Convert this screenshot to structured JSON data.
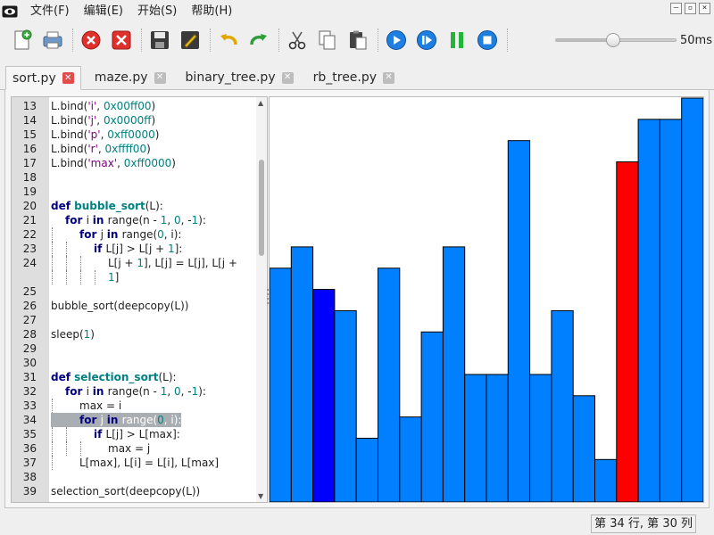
{
  "menubar": {
    "items": [
      {
        "label": "文件(F)",
        "name": "menu-file"
      },
      {
        "label": "编辑(E)",
        "name": "menu-edit"
      },
      {
        "label": "开始(S)",
        "name": "menu-start"
      },
      {
        "label": "帮助(H)",
        "name": "menu-help"
      }
    ]
  },
  "toolbar": {
    "speed_value": 0.48,
    "speed_label": "50ms"
  },
  "tabs": [
    {
      "label": "sort.py",
      "active": true
    },
    {
      "label": "maze.py",
      "active": false
    },
    {
      "label": "binary_tree.py",
      "active": false
    },
    {
      "label": "rb_tree.py",
      "active": false
    }
  ],
  "editor": {
    "lines": [
      {
        "n": "13",
        "indent": 0,
        "tokens": [
          [
            "L.bind(",
            ""
          ],
          [
            "'i'",
            "str"
          ],
          [
            ", ",
            ""
          ],
          [
            "0x00ff00",
            "num"
          ],
          [
            ")",
            ""
          ]
        ]
      },
      {
        "n": "14",
        "indent": 0,
        "tokens": [
          [
            "L.bind(",
            ""
          ],
          [
            "'j'",
            "str"
          ],
          [
            ", ",
            ""
          ],
          [
            "0x0000ff",
            "num"
          ],
          [
            ")",
            ""
          ]
        ]
      },
      {
        "n": "15",
        "indent": 0,
        "tokens": [
          [
            "L.bind(",
            ""
          ],
          [
            "'p'",
            "str"
          ],
          [
            ", ",
            ""
          ],
          [
            "0xff0000",
            "num"
          ],
          [
            ")",
            ""
          ]
        ]
      },
      {
        "n": "16",
        "indent": 0,
        "tokens": [
          [
            "L.bind(",
            ""
          ],
          [
            "'r'",
            "str"
          ],
          [
            ", ",
            ""
          ],
          [
            "0xffff00",
            "num"
          ],
          [
            ")",
            ""
          ]
        ]
      },
      {
        "n": "17",
        "indent": 0,
        "tokens": [
          [
            "L.bind(",
            ""
          ],
          [
            "'max'",
            "str"
          ],
          [
            ", ",
            ""
          ],
          [
            "0xff0000",
            "num"
          ],
          [
            ")",
            ""
          ]
        ]
      },
      {
        "n": "18",
        "indent": 0,
        "tokens": []
      },
      {
        "n": "19",
        "indent": 0,
        "tokens": []
      },
      {
        "n": "20",
        "indent": 0,
        "tokens": [
          [
            "def ",
            "kw"
          ],
          [
            "bubble_sort",
            "fn"
          ],
          [
            "(L):",
            ""
          ]
        ]
      },
      {
        "n": "21",
        "indent": 1,
        "tokens": [
          [
            "for ",
            "kw"
          ],
          [
            "i ",
            ""
          ],
          [
            "in ",
            "kw"
          ],
          [
            "range(n - ",
            ""
          ],
          [
            "1",
            "num"
          ],
          [
            ", ",
            ""
          ],
          [
            "0",
            "num"
          ],
          [
            ", -",
            ""
          ],
          [
            "1",
            "num"
          ],
          [
            "):",
            ""
          ]
        ]
      },
      {
        "n": "22",
        "indent": 2,
        "tokens": [
          [
            "for ",
            "kw"
          ],
          [
            "j ",
            ""
          ],
          [
            "in ",
            "kw"
          ],
          [
            "range(",
            ""
          ],
          [
            "0",
            "num"
          ],
          [
            ", i):",
            ""
          ]
        ]
      },
      {
        "n": "23",
        "indent": 3,
        "tokens": [
          [
            "if ",
            "kw"
          ],
          [
            "L[j] > L[j + ",
            ""
          ],
          [
            "1",
            "num"
          ],
          [
            "]:",
            ""
          ]
        ]
      },
      {
        "n": "24",
        "indent": 4,
        "tokens": [
          [
            "L[j + ",
            ""
          ],
          [
            "1",
            "num"
          ],
          [
            "], L[j] = L[j], L[j +",
            ""
          ]
        ]
      },
      {
        "n": "",
        "indent": 4,
        "cont": true,
        "tokens": [
          [
            "1",
            "num"
          ],
          [
            "]",
            ""
          ]
        ]
      },
      {
        "n": "25",
        "indent": 0,
        "tokens": []
      },
      {
        "n": "26",
        "indent": 0,
        "tokens": [
          [
            "bubble_sort(deepcopy(L))",
            ""
          ]
        ]
      },
      {
        "n": "27",
        "indent": 0,
        "tokens": []
      },
      {
        "n": "28",
        "indent": 0,
        "tokens": [
          [
            "sleep(",
            ""
          ],
          [
            "1",
            "num"
          ],
          [
            ")",
            ""
          ]
        ]
      },
      {
        "n": "29",
        "indent": 0,
        "tokens": []
      },
      {
        "n": "30",
        "indent": 0,
        "tokens": []
      },
      {
        "n": "31",
        "indent": 0,
        "tokens": [
          [
            "def ",
            "kw"
          ],
          [
            "selection_sort",
            "fn"
          ],
          [
            "(L):",
            ""
          ]
        ]
      },
      {
        "n": "32",
        "indent": 1,
        "tokens": [
          [
            "for ",
            "kw"
          ],
          [
            "i ",
            ""
          ],
          [
            "in ",
            "kw"
          ],
          [
            "range(n - ",
            ""
          ],
          [
            "1",
            "num"
          ],
          [
            ", ",
            ""
          ],
          [
            "0",
            "num"
          ],
          [
            ", -",
            ""
          ],
          [
            "1",
            "num"
          ],
          [
            "):",
            ""
          ]
        ]
      },
      {
        "n": "33",
        "indent": 2,
        "tokens": [
          [
            "max = i",
            ""
          ]
        ]
      },
      {
        "n": "34",
        "indent": 2,
        "highlight": true,
        "tokens": [
          [
            "for ",
            "kw"
          ],
          [
            "j ",
            ""
          ],
          [
            "in ",
            "kw"
          ],
          [
            "range(",
            ""
          ],
          [
            "0",
            "num"
          ],
          [
            ", i):",
            ""
          ]
        ]
      },
      {
        "n": "35",
        "indent": 3,
        "tokens": [
          [
            "if ",
            "kw"
          ],
          [
            "L[j] > L[max]:",
            ""
          ]
        ]
      },
      {
        "n": "36",
        "indent": 4,
        "tokens": [
          [
            "max = j",
            ""
          ]
        ]
      },
      {
        "n": "37",
        "indent": 2,
        "tokens": [
          [
            "L[max], L[i] = L[i], L[max]",
            ""
          ]
        ]
      },
      {
        "n": "38",
        "indent": 0,
        "tokens": []
      },
      {
        "n": "39",
        "indent": 0,
        "tokens": [
          [
            "selection_sort(deepcopy(L))",
            ""
          ]
        ]
      }
    ]
  },
  "chart_data": {
    "type": "bar",
    "ylim": [
      0,
      19
    ],
    "values": [
      11,
      12,
      10,
      9,
      3,
      11,
      4,
      8,
      12,
      6,
      6,
      17,
      6,
      9,
      5,
      2,
      16,
      18,
      18,
      19
    ],
    "colors": [
      "#0080ff",
      "#0080ff",
      "#0000ff",
      "#0080ff",
      "#0080ff",
      "#0080ff",
      "#0080ff",
      "#0080ff",
      "#0080ff",
      "#0080ff",
      "#0080ff",
      "#0080ff",
      "#0080ff",
      "#0080ff",
      "#0080ff",
      "#0080ff",
      "#ff0000",
      "#0080ff",
      "#0080ff",
      "#0080ff"
    ]
  },
  "status": {
    "text": "第 34 行, 第 30 列"
  }
}
